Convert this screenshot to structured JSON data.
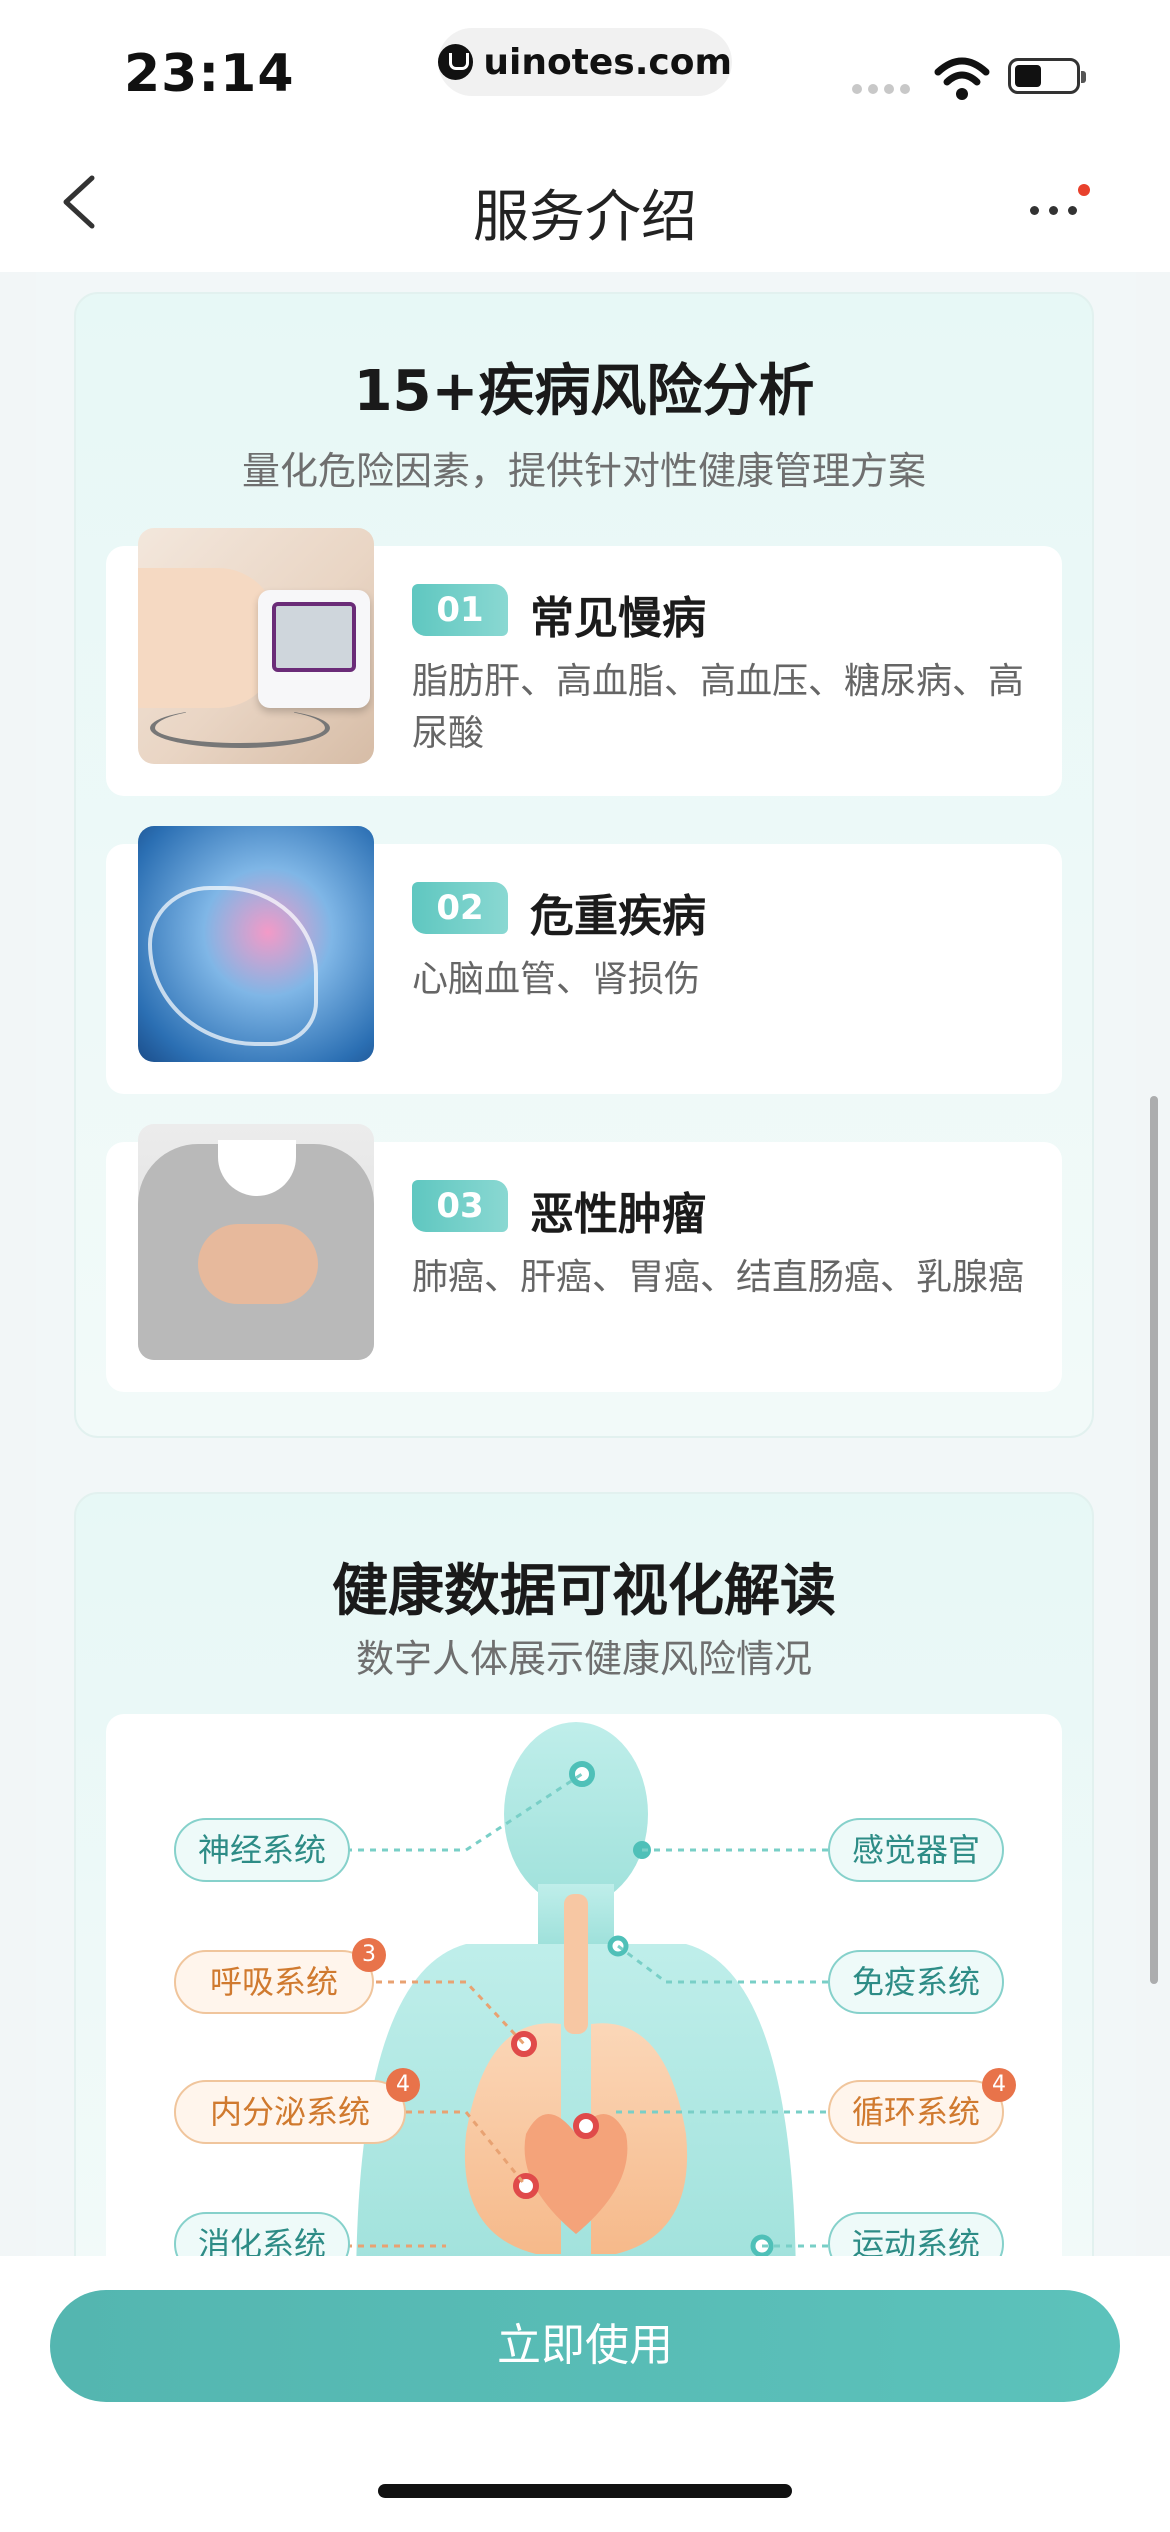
{
  "status_bar": {
    "time": "23:14",
    "url": "uinotes.com"
  },
  "nav": {
    "title": "服务介绍"
  },
  "risk_section": {
    "title": "15+疾病风险分析",
    "subtitle": "量化危险因素，提供针对性健康管理方案",
    "items": [
      {
        "num": "01",
        "title": "常见慢病",
        "desc": "脂肪肝、高血脂、高血压、糖尿病、高尿酸",
        "image_icon": "blood-pressure-monitor-image"
      },
      {
        "num": "02",
        "title": "危重疾病",
        "desc": "心脑血管、肾损伤",
        "image_icon": "heart-hand-image"
      },
      {
        "num": "03",
        "title": "恶性肿瘤",
        "desc": "肺癌、肝癌、胃癌、结直肠癌、乳腺癌",
        "image_icon": "chest-pain-image"
      }
    ]
  },
  "visual_section": {
    "title": "健康数据可视化解读",
    "subtitle": "数字人体展示健康风险情况",
    "left_tags": [
      {
        "label": "神经系统",
        "badge": ""
      },
      {
        "label": "呼吸系统",
        "badge": "3"
      },
      {
        "label": "内分泌系统",
        "badge": "4"
      },
      {
        "label": "消化系统",
        "badge": ""
      }
    ],
    "right_tags": [
      {
        "label": "感觉器官",
        "badge": ""
      },
      {
        "label": "免疫系统",
        "badge": ""
      },
      {
        "label": "循环系统",
        "badge": "4"
      },
      {
        "label": "运动系统",
        "badge": ""
      }
    ]
  },
  "cta": {
    "label": "立即使用"
  },
  "colors": {
    "accent": "#5cbfb9",
    "warning": "#e8734a"
  }
}
